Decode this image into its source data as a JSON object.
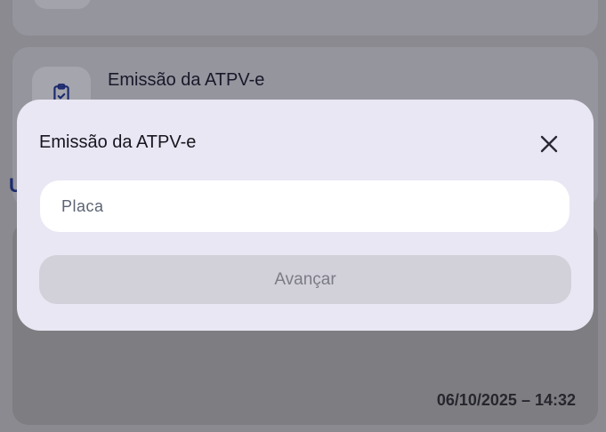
{
  "background": {
    "card_title": "Emissão da ATPV-e",
    "side_letter": "U",
    "timestamp": "06/10/2025 – 14:32"
  },
  "modal": {
    "title": "Emissão da ATPV-e",
    "close_icon": "close-icon",
    "plate_input": {
      "value": "",
      "placeholder": "Placa"
    },
    "advance_button_label": "Avançar"
  },
  "colors": {
    "overlay": "#808084",
    "modal_bg": "#e9e7f3",
    "input_bg": "#ffffff",
    "button_disabled_bg": "#d2d1da",
    "button_disabled_text": "#7c7c86",
    "accent_navy": "#1c2a6e"
  }
}
